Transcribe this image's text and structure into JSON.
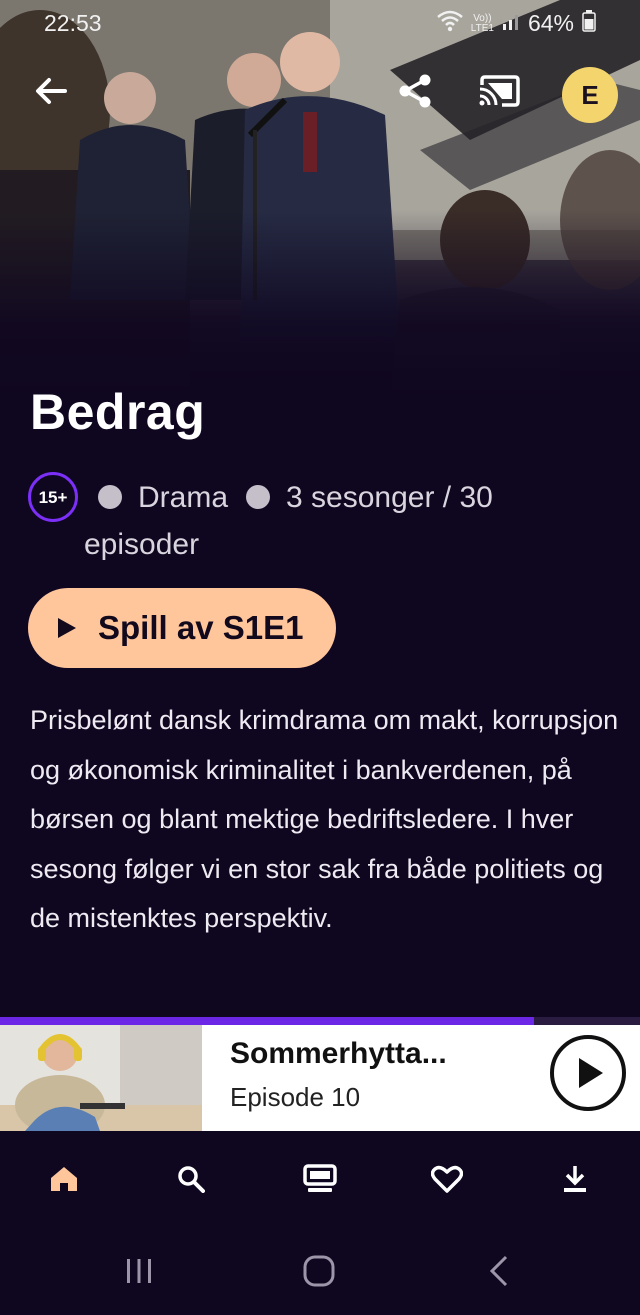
{
  "status_bar": {
    "time": "22:53",
    "network_top": "Vo))",
    "network_bottom": "LTE1",
    "battery": "64%"
  },
  "header": {
    "back_icon": "arrow-left-icon",
    "share_icon": "share-icon",
    "cast_icon": "cast-icon",
    "avatar_initial": "E"
  },
  "show": {
    "title": "Bedrag",
    "age_rating": "15+",
    "genre": "Drama",
    "seasons_episodes": "3 sesonger / 30",
    "seasons_episodes_cont": "episoder",
    "play_label": "Spill av S1E1",
    "description": "Prisbelønt dansk krimdrama om makt, korrupsjon og økonomisk kriminalitet i bankverdenen, på børsen og blant mektige bedriftsledere. I hver sesong følger vi en stor sak fra både politiets og de mistenktes perspektiv."
  },
  "mini_player": {
    "title": "Sommerhytta...",
    "subtitle": "Episode 10",
    "progress": 0.835
  },
  "bottom_nav": {
    "items": [
      {
        "icon": "home-icon",
        "active": true
      },
      {
        "icon": "search-icon",
        "active": false
      },
      {
        "icon": "tv-icon",
        "active": false
      },
      {
        "icon": "heart-icon",
        "active": false
      },
      {
        "icon": "download-icon",
        "active": false
      }
    ]
  },
  "system_nav": {
    "items": [
      "recent-apps-icon",
      "home-circle-icon",
      "back-chevron-icon"
    ]
  },
  "colors": {
    "background": "#0f0620",
    "accent_purple": "#7b2ff7",
    "play_button": "#ffc59b",
    "active_nav": "#ffc59b",
    "avatar_bg": "#f4d46c"
  }
}
